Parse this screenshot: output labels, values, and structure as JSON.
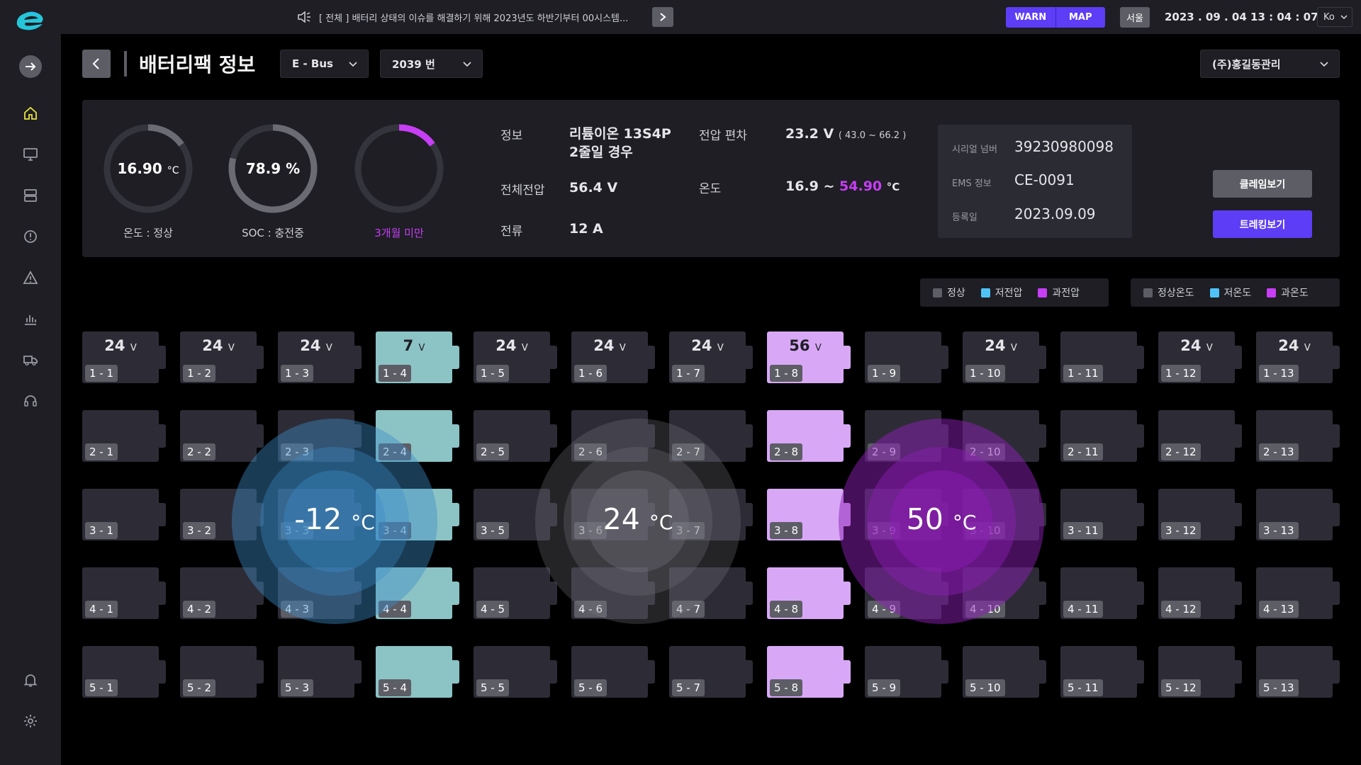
{
  "topbar": {
    "notice": "[ 전체 ]  배터리 상태의 이슈를 해결하기 위해 2023년도 하반기부터 00시스템...",
    "warn_label": "WARN",
    "map_label": "MAP",
    "city": "서울",
    "datetime": "2023 . 09 . 04    13 : 04 : 07",
    "lang": "Ko"
  },
  "header": {
    "title": "배터리팩 정보",
    "vehicle_select": "E - Bus",
    "number_select": "2039 번",
    "company_select": "(주)홍길동관리"
  },
  "summary": {
    "temp_gauge": {
      "value": "16.90",
      "unit": "°C",
      "label": "온도 : 정상",
      "level": 0.15
    },
    "soc_gauge": {
      "value": "78.9",
      "unit": "%",
      "label": "SOC : 충전중",
      "level": 0.789
    },
    "age_gauge": {
      "label": "3개월 미만",
      "level": 0.15
    },
    "info_label": "정보",
    "info_line1": "리튬이온 13S4P",
    "info_line2": "2줄일 경우",
    "total_voltage_label": "전체전압",
    "total_voltage": "56.4 V",
    "current_label": "전류",
    "current": "12 A",
    "voltage_dev_label": "전압 편차",
    "voltage_dev": "23.2 V",
    "voltage_dev_range": "( 43.0 ~ 66.2 )",
    "temp_label": "온도",
    "temp_min": "16.9 ~ ",
    "temp_max": "54.90",
    "temp_unit": "°C",
    "serial_label": "시리얼 넘버",
    "serial": "39230980098",
    "ems_label": "EMS 정보",
    "ems": "CE-0091",
    "reg_label": "등록일",
    "reg_date": "2023.09.09",
    "claim_button": "클레임보기",
    "track_button": "트레킹보기"
  },
  "legend_voltage": [
    {
      "label": "정상",
      "color": "#5d5d66"
    },
    {
      "label": "저전압",
      "color": "#4fc3f7"
    },
    {
      "label": "과전압",
      "color": "#c73ef5"
    }
  ],
  "legend_temp": [
    {
      "label": "정상온도",
      "color": "#5d5d66"
    },
    {
      "label": "저온도",
      "color": "#4fc3f7"
    },
    {
      "label": "과온도",
      "color": "#c73ef5"
    }
  ],
  "cells": {
    "rows": 5,
    "cols": 13,
    "low_col": 4,
    "over_col": 8,
    "row1_voltages": [
      "24",
      "24",
      "24",
      "7",
      "24",
      "24",
      "24",
      "56",
      "",
      "24",
      "",
      "24",
      "24"
    ],
    "volt_unit": "V"
  },
  "temp_zones": [
    {
      "value": "-12",
      "unit": "°C",
      "kind": "low"
    },
    {
      "value": "24",
      "unit": "°C",
      "kind": "normal"
    },
    {
      "value": "50",
      "unit": "°C",
      "kind": "high"
    }
  ],
  "colors": {
    "accent": "#5d3df5",
    "low": "#8cc3c5",
    "over": "#d8a8f7",
    "normal": "#2d2c36"
  }
}
